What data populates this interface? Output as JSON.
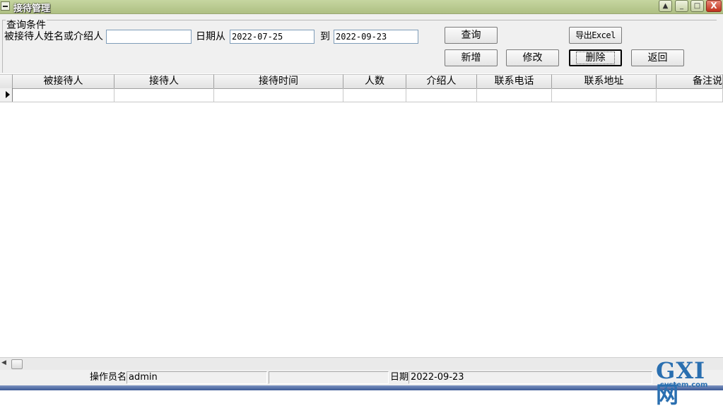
{
  "window": {
    "title": "接待管理",
    "min_label": "_",
    "max_label": "□",
    "close_label": "X",
    "help_label": "▲"
  },
  "query": {
    "group_title": "查询条件",
    "name_label": "被接待人姓名或介绍人",
    "name_value": "",
    "date_from_label": "日期从",
    "date_from_value": "2022-07-25",
    "date_to_label": "到",
    "date_to_value": "2022-09-23"
  },
  "buttons": {
    "query": "查询",
    "export": "导出Excel",
    "add": "新增",
    "edit": "修改",
    "delete": "删除",
    "back": "返回"
  },
  "grid": {
    "columns": [
      "被接待人",
      "接待人",
      "接待时间",
      "人数",
      "介绍人",
      "联系电话",
      "联系地址",
      "备注说"
    ]
  },
  "status": {
    "operator_label": "操作员名",
    "operator_value": "admin",
    "date_label": "日期",
    "date_value": "2022-09-23"
  },
  "watermark": {
    "main": "GXI网",
    "sub": "system.com"
  },
  "colors": {
    "titlebar": "#aebf83",
    "close": "#c0301a",
    "logo": "#2a6fb0"
  }
}
